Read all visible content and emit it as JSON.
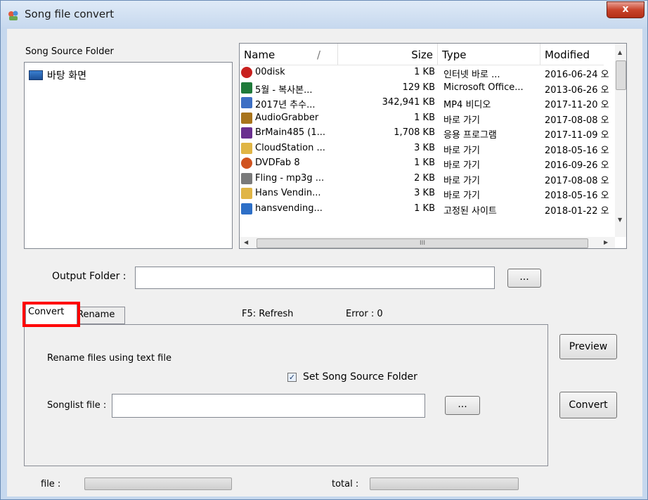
{
  "window": {
    "title": "Song file convert",
    "close_label": "x"
  },
  "source": {
    "label": "Song Source Folder",
    "tree_item": "바탕 화면"
  },
  "file_list": {
    "columns": {
      "name": "Name",
      "sort_indicator": "/",
      "size": "Size",
      "type": "Type",
      "modified": "Modified"
    },
    "rows": [
      {
        "name": "00disk",
        "size": "1 KB",
        "type": "인터넷 바로 ...",
        "modified": "2016-06-24 오",
        "icon": "globe-shortcut-icon",
        "color": "#c8201e"
      },
      {
        "name": "5월 - 복사본...",
        "size": "129 KB",
        "type": "Microsoft Office...",
        "modified": "2013-06-26 오",
        "icon": "excel-file-icon",
        "color": "#1f7a3a"
      },
      {
        "name": "2017년 추수...",
        "size": "342,941 KB",
        "type": "MP4 비디오",
        "modified": "2017-11-20 오",
        "icon": "video-file-icon",
        "color": "#3d6fc4"
      },
      {
        "name": "AudioGrabber",
        "size": "1 KB",
        "type": "바로 가기",
        "modified": "2017-08-08 오",
        "icon": "audiograbber-icon",
        "color": "#a8741c"
      },
      {
        "name": "BrMain485 (1...",
        "size": "1,708 KB",
        "type": "응용 프로그램",
        "modified": "2017-11-09 오",
        "icon": "app-exe-icon",
        "color": "#6a2f8f"
      },
      {
        "name": "CloudStation ...",
        "size": "3 KB",
        "type": "바로 가기",
        "modified": "2018-05-16 오",
        "icon": "folder-shortcut-icon",
        "color": "#e0b545"
      },
      {
        "name": "DVDFab 8",
        "size": "1 KB",
        "type": "바로 가기",
        "modified": "2016-09-26 오",
        "icon": "dvdfab-icon",
        "color": "#d0531f"
      },
      {
        "name": "Fling - mp3g ...",
        "size": "2 KB",
        "type": "바로 가기",
        "modified": "2017-08-08 오",
        "icon": "shortcut-icon",
        "color": "#7a7a7a"
      },
      {
        "name": "Hans Vendin...",
        "size": "3 KB",
        "type": "바로 가기",
        "modified": "2018-05-16 오",
        "icon": "folder-shortcut-icon",
        "color": "#e0b545"
      },
      {
        "name": "hansvending...",
        "size": "1 KB",
        "type": "고정된 사이트",
        "modified": "2018-01-22 오",
        "icon": "pinned-site-icon",
        "color": "#2d6fc7"
      }
    ],
    "scroll_grip": "III"
  },
  "output": {
    "label": "Output Folder :",
    "value": "",
    "browse_label": "..."
  },
  "tabs": {
    "convert": "Convert",
    "rename": "Rename",
    "active": "Convert"
  },
  "status": {
    "refresh_hint": "F5: Refresh",
    "error": "Error : 0"
  },
  "panel": {
    "instruction": "Rename files using text file",
    "set_source_label": "Set Song Source Folder",
    "set_source_checked": "✓",
    "songlist_label": "Songlist file :",
    "songlist_value": "",
    "songlist_browse": "..."
  },
  "actions": {
    "preview": "Preview",
    "convert": "Convert"
  },
  "progress": {
    "file_label": "file :",
    "total_label": "total :",
    "file_value": 0,
    "total_value": 0
  },
  "highlight": {
    "color": "#ff0000"
  }
}
